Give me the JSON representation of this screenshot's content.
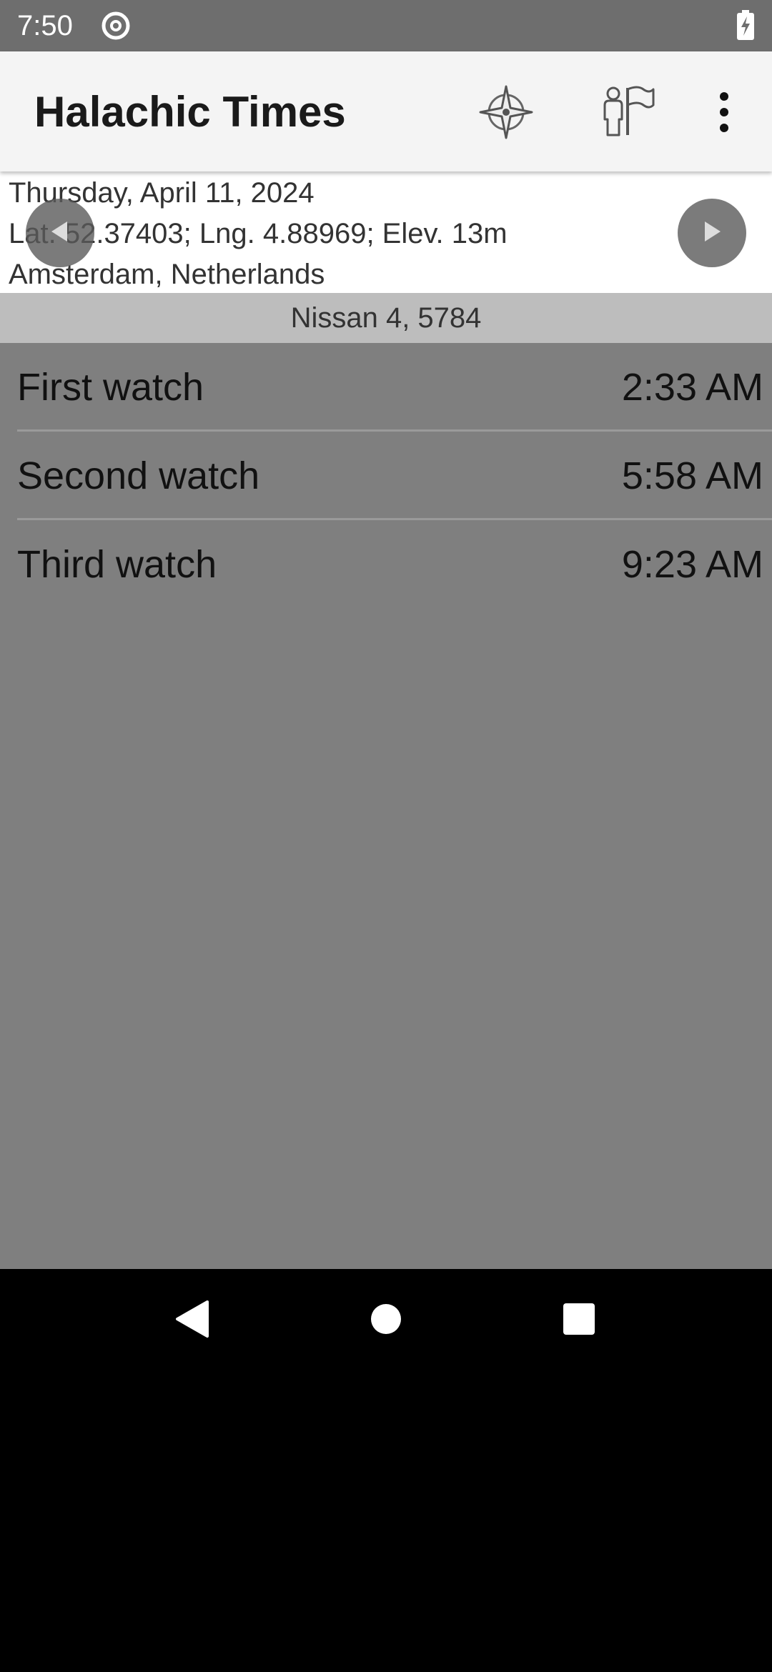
{
  "status_bar": {
    "time": "7:50",
    "icons": [
      "data-saver-icon",
      "battery-charging-icon"
    ]
  },
  "app_bar": {
    "title": "Halachic Times",
    "actions": [
      {
        "name": "location-compass-icon"
      },
      {
        "name": "place-person-icon"
      },
      {
        "name": "overflow-menu-icon"
      }
    ]
  },
  "date_header": {
    "date": "Thursday, April 11, 2024",
    "coordinates": "Lat. 52.37403; Lng. 4.88969; Elev. 13m",
    "location": "Amsterdam, Netherlands",
    "prev_icon": "arrow-left-icon",
    "next_icon": "arrow-right-icon"
  },
  "hebrew_date": "Nissan 4, 5784",
  "times": [
    {
      "label": "First watch",
      "time": "2:33 AM"
    },
    {
      "label": "Second watch",
      "time": "5:58 AM"
    },
    {
      "label": "Third watch",
      "time": "9:23 AM"
    }
  ],
  "nav_bar": {
    "buttons": [
      "back-icon",
      "home-icon",
      "recents-icon"
    ]
  },
  "colors": {
    "status_bar": "#6e6e6e",
    "app_bar": "#f4f4f4",
    "hebrew_bar": "#bdbdbd",
    "list_background": "#7f7f7f"
  }
}
